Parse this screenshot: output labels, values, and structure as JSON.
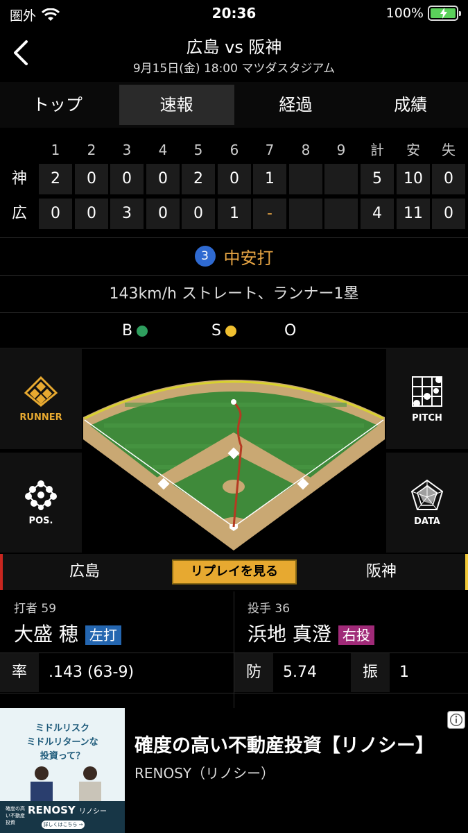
{
  "status": {
    "carrier": "圏外",
    "time": "20:36",
    "battery": "100%"
  },
  "header": {
    "title": "広島 vs 阪神",
    "subtitle": "9月15日(金) 18:00 マツダスタジアム"
  },
  "tabs": [
    {
      "label": "トップ",
      "active": false
    },
    {
      "label": "速報",
      "active": true
    },
    {
      "label": "経過",
      "active": false
    },
    {
      "label": "成績",
      "active": false
    }
  ],
  "scoreboard": {
    "headers": [
      "1",
      "2",
      "3",
      "4",
      "5",
      "6",
      "7",
      "8",
      "9",
      "計",
      "安",
      "失"
    ],
    "rows": [
      {
        "team": "神",
        "innings": [
          "2",
          "0",
          "0",
          "0",
          "2",
          "0",
          "1",
          "",
          ""
        ],
        "totals": [
          "5",
          "10",
          "0"
        ]
      },
      {
        "team": "広",
        "innings": [
          "0",
          "0",
          "3",
          "0",
          "0",
          "1",
          "-",
          "",
          ""
        ],
        "totals": [
          "4",
          "11",
          "0"
        ]
      }
    ]
  },
  "play": {
    "number": "3",
    "result": "中安打",
    "description": "143km/h ストレート、ランナー1塁"
  },
  "count": {
    "b_label": "B",
    "s_label": "S",
    "o_label": "O",
    "balls": 1,
    "strikes": 1,
    "outs": 0
  },
  "side_buttons": {
    "runner": "RUNNER",
    "pitch": "PITCH",
    "pos": "POS.",
    "data": "DATA"
  },
  "teambar": {
    "home": "広島",
    "away": "阪神",
    "replay": "リプレイを見る"
  },
  "batter": {
    "role": "打者 59",
    "name": "大盛 穂",
    "hand": "左打"
  },
  "pitcher": {
    "role": "投手 36",
    "name": "浜地 真澄",
    "hand": "右投"
  },
  "stats": {
    "batter_key": "率",
    "batter_val": ".143 (63-9)",
    "pitcher_key1": "防",
    "pitcher_val1": "5.74",
    "pitcher_key2": "振",
    "pitcher_val2": "1"
  },
  "colors": {
    "accent": "#e7a544",
    "ball": "#2e9e5e",
    "strike": "#f0c030",
    "home": "#c8261f",
    "away": "#f0c838"
  },
  "ad": {
    "copy1": "ミドルリスク",
    "copy2": "ミドルリターンな",
    "copy3": "投資って？",
    "brand": "RENOSY",
    "brand_sub": "リノシー",
    "small": "確度の高い不動産投資",
    "cta": "詳しくはこちら →",
    "headline": "確度の高い不動産投資【リノシー】",
    "sponsor": "RENOSY（リノシー）"
  }
}
